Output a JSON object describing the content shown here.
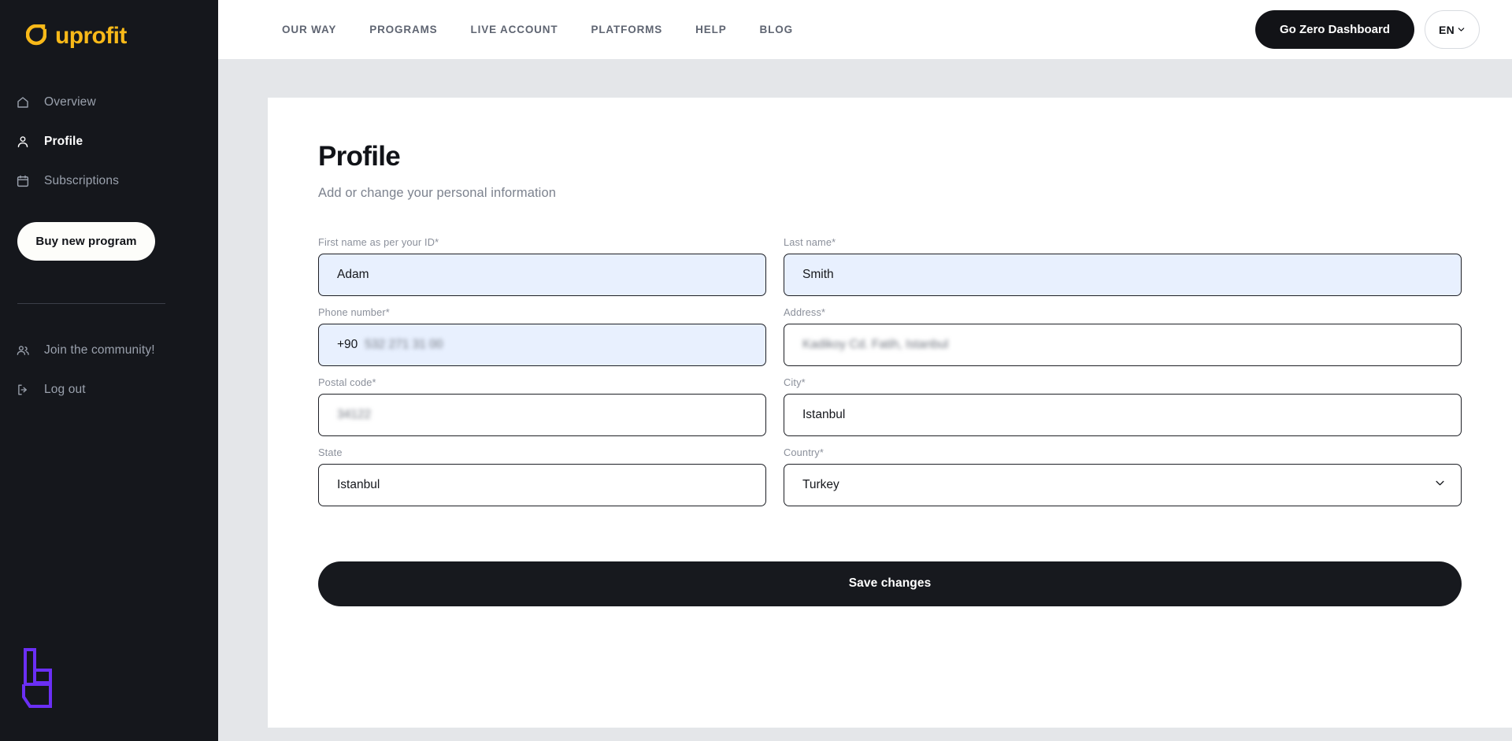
{
  "brand": {
    "name": "uprofit",
    "logo_color": "#f8b919",
    "mark": "u-circle-logo"
  },
  "sidebar": {
    "items": [
      {
        "label": "Overview",
        "icon": "home-icon",
        "active": false
      },
      {
        "label": "Profile",
        "icon": "user-icon",
        "active": true
      },
      {
        "label": "Subscriptions",
        "icon": "calendar-icon",
        "active": false
      }
    ],
    "buy_button": "Buy new program",
    "bottom_items": [
      {
        "label": "Join the community!",
        "icon": "users-icon"
      },
      {
        "label": "Log out",
        "icon": "logout-icon"
      }
    ],
    "footer_logo": {
      "name": "uprofit-monogram",
      "color": "#6b2ff5"
    },
    "background": "#15171c"
  },
  "topbar": {
    "nav": [
      "OUR WAY",
      "PROGRAMS",
      "LIVE ACCOUNT",
      "PLATFORMS",
      "HELP",
      "BLOG"
    ],
    "dashboard_button": "Go Zero Dashboard",
    "language": "EN",
    "language_icon": "chevron-down-icon"
  },
  "main": {
    "title": "Profile",
    "subtitle": "Add or change your personal information",
    "save_button": "Save changes",
    "fields": [
      {
        "id": "first-name",
        "label": "First name as per your ID*",
        "value": "Adam",
        "autofilled": true,
        "redacted": false,
        "type": "text"
      },
      {
        "id": "last-name",
        "label": "Last name*",
        "value": "Smith",
        "autofilled": true,
        "redacted": false,
        "type": "text"
      },
      {
        "id": "phone-number",
        "label": "Phone number*",
        "prefix": "+90",
        "value": "532 271 31 00",
        "autofilled": true,
        "redacted": true,
        "type": "tel"
      },
      {
        "id": "address",
        "label": "Address*",
        "value": "Kadikoy Cd. Fatih, Istanbul",
        "autofilled": false,
        "redacted": true,
        "type": "text"
      },
      {
        "id": "postal-code",
        "label": "Postal code*",
        "value": "34122",
        "autofilled": false,
        "redacted": true,
        "type": "text"
      },
      {
        "id": "city",
        "label": "City*",
        "value": "Istanbul",
        "autofilled": false,
        "redacted": false,
        "type": "text"
      },
      {
        "id": "state",
        "label": "State",
        "value": "Istanbul",
        "autofilled": false,
        "redacted": false,
        "type": "text"
      },
      {
        "id": "country",
        "label": "Country*",
        "value": "Turkey",
        "autofilled": false,
        "redacted": false,
        "type": "select",
        "icon": "chevron-down-icon"
      }
    ]
  },
  "colors": {
    "sidebar_bg": "#15171c",
    "page_bg": "#e4e6e9",
    "card_bg": "#ffffff",
    "accent_yellow": "#f8b919",
    "accent_purple": "#6b2ff5",
    "autofill_blue": "#e8f0fe",
    "button_dark": "#17191e"
  }
}
